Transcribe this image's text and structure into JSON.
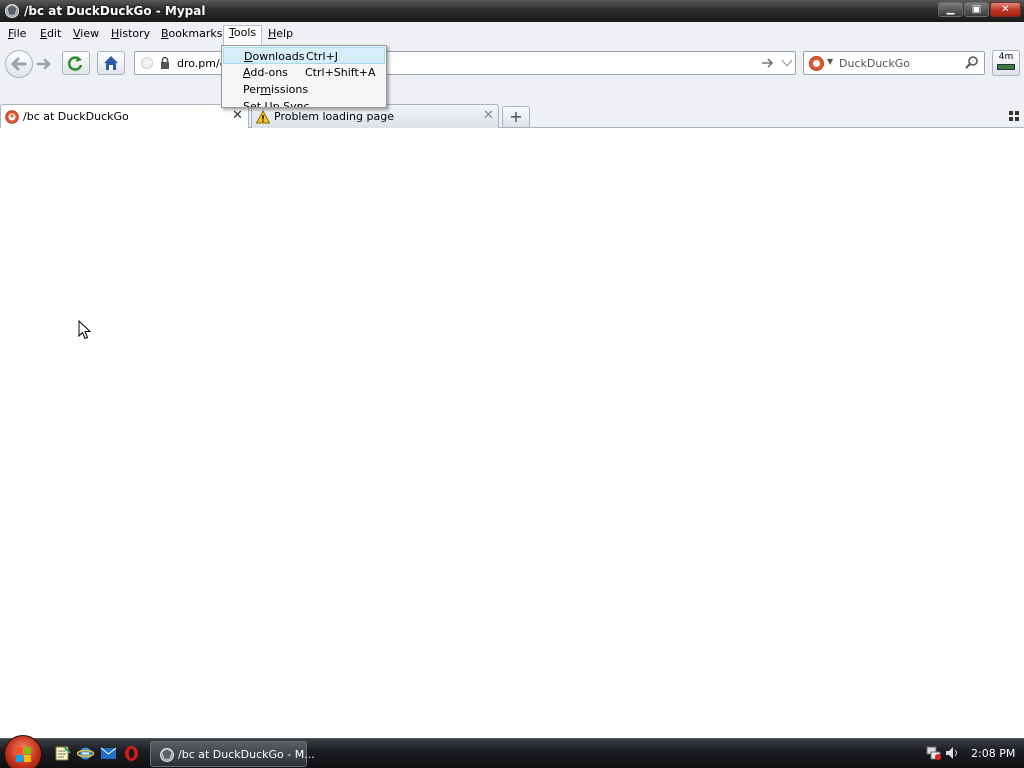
{
  "window": {
    "title": "/bc at DuckDuckGo - Mypal",
    "controls": {
      "minimize": "▁",
      "maximize": "▣",
      "close": "✕"
    }
  },
  "menubar": {
    "items": [
      {
        "label": "File",
        "underline": "F",
        "rest": "ile"
      },
      {
        "label": "Edit",
        "underline": "E",
        "rest": "dit"
      },
      {
        "label": "View",
        "underline": "V",
        "rest": "iew"
      },
      {
        "label": "History",
        "underline": "H",
        "rest": "istory"
      },
      {
        "label": "Bookmarks",
        "underline": "B",
        "rest": "ookmarks"
      },
      {
        "label": "Tools",
        "underline": "T",
        "rest": "ools"
      },
      {
        "label": "Help",
        "underline": "H",
        "rest": "elp"
      }
    ]
  },
  "navbar": {
    "url": "dro.pm/cq",
    "search_placeholder": "DuckDuckGo",
    "timer_label": "4m"
  },
  "tools_menu": {
    "items": [
      {
        "u": "D",
        "rest": "ownloads",
        "shortcut": "Ctrl+J",
        "highlighted": true
      },
      {
        "u": "A",
        "rest": "dd-ons",
        "shortcut": "Ctrl+Shift+A",
        "highlighted": false
      },
      {
        "pre": "Per",
        "u": "m",
        "rest": "issions",
        "shortcut": "",
        "highlighted": false
      },
      {
        "pre": "",
        "u": "S",
        "rest": "et Up Sync...",
        "shortcut": "",
        "highlighted": false
      }
    ]
  },
  "tabs": [
    {
      "label": "/bc at DuckDuckGo",
      "active": true,
      "icon": "duckduckgo-icon"
    },
    {
      "label": "Problem loading page",
      "active": false,
      "icon": "warning-icon"
    }
  ],
  "taskbar": {
    "task_label": "/bc at DuckDuckGo - M...",
    "clock": "2:08 PM"
  },
  "colors": {
    "accent_menu_hover": "#d5eef9",
    "titlebar": "#2e2e2e",
    "duckduckgo": "#de5833"
  }
}
